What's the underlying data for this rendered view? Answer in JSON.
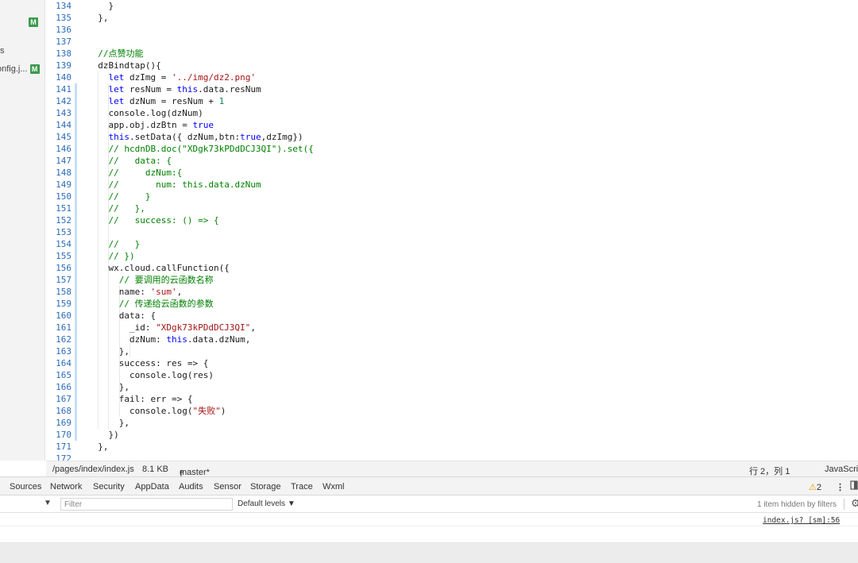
{
  "sidebar": {
    "items": [
      {
        "label": "",
        "badge": "M"
      },
      {
        "label": "s",
        "badge": ""
      },
      {
        "label": "onfig.j...",
        "badge": "M"
      }
    ]
  },
  "editor": {
    "lines": [
      {
        "n": "134",
        "text": "    }"
      },
      {
        "n": "135",
        "text": "  },"
      },
      {
        "n": "136",
        "text": ""
      },
      {
        "n": "137",
        "text": ""
      },
      {
        "n": "138",
        "text": "  //点赞功能"
      },
      {
        "n": "139",
        "text": "  dzBindtap(){"
      },
      {
        "n": "140",
        "text": "    let dzImg = '../img/dz2.png'"
      },
      {
        "n": "141",
        "text": "    let resNum = this.data.resNum"
      },
      {
        "n": "142",
        "text": "    let dzNum = resNum + 1"
      },
      {
        "n": "143",
        "text": "    console.log(dzNum)"
      },
      {
        "n": "144",
        "text": "    app.obj.dzBtn = true"
      },
      {
        "n": "145",
        "text": "    this.setData({ dzNum,btn:true,dzImg})"
      },
      {
        "n": "146",
        "text": "    // hcdnDB.doc(\"XDgk73kPDdDCJ3QI\").set({"
      },
      {
        "n": "147",
        "text": "    //   data: {"
      },
      {
        "n": "148",
        "text": "    //     dzNum:{"
      },
      {
        "n": "149",
        "text": "    //       num: this.data.dzNum"
      },
      {
        "n": "150",
        "text": "    //     }"
      },
      {
        "n": "151",
        "text": "    //   },"
      },
      {
        "n": "152",
        "text": "    //   success: () => {"
      },
      {
        "n": "153",
        "text": ""
      },
      {
        "n": "154",
        "text": "    //   }"
      },
      {
        "n": "155",
        "text": "    // })"
      },
      {
        "n": "156",
        "text": "    wx.cloud.callFunction({"
      },
      {
        "n": "157",
        "text": "      // 要调用的云函数名称"
      },
      {
        "n": "158",
        "text": "      name: 'sum',"
      },
      {
        "n": "159",
        "text": "      // 传递给云函数的参数"
      },
      {
        "n": "160",
        "text": "      data: {"
      },
      {
        "n": "161",
        "text": "        _id: \"XDgk73kPDdDCJ3QI\","
      },
      {
        "n": "162",
        "text": "        dzNum: this.data.dzNum,"
      },
      {
        "n": "163",
        "text": "      },"
      },
      {
        "n": "164",
        "text": "      success: res => {"
      },
      {
        "n": "165",
        "text": "        console.log(res)"
      },
      {
        "n": "166",
        "text": "      },"
      },
      {
        "n": "167",
        "text": "      fail: err => {"
      },
      {
        "n": "168",
        "text": "        console.log(\"失败\")"
      },
      {
        "n": "169",
        "text": "      },"
      },
      {
        "n": "170",
        "text": "    })"
      },
      {
        "n": "171",
        "text": "  },"
      },
      {
        "n": "172",
        "text": ""
      }
    ]
  },
  "statusbar": {
    "path": "/pages/index/index.js",
    "size": "8.1 KB",
    "branch": "master*",
    "cursor": "行 2，列 1",
    "language": "JavaScript"
  },
  "devtools": {
    "tabs": [
      "Sources",
      "Network",
      "Security",
      "AppData",
      "Audits",
      "Sensor",
      "Storage",
      "Trace",
      "Wxml"
    ],
    "warning_count": "2",
    "filter_placeholder": "Filter",
    "levels": "Default levels",
    "hidden_note": "1 item hidden by filters",
    "log_source": "index.js? [sm]:56"
  },
  "colors": {
    "keyword": "#0000ff",
    "string": "#a31515",
    "comment": "#008000",
    "line_number": "#2b6cb8",
    "badge": "#3c9a4c",
    "warning": "#e8a400"
  }
}
